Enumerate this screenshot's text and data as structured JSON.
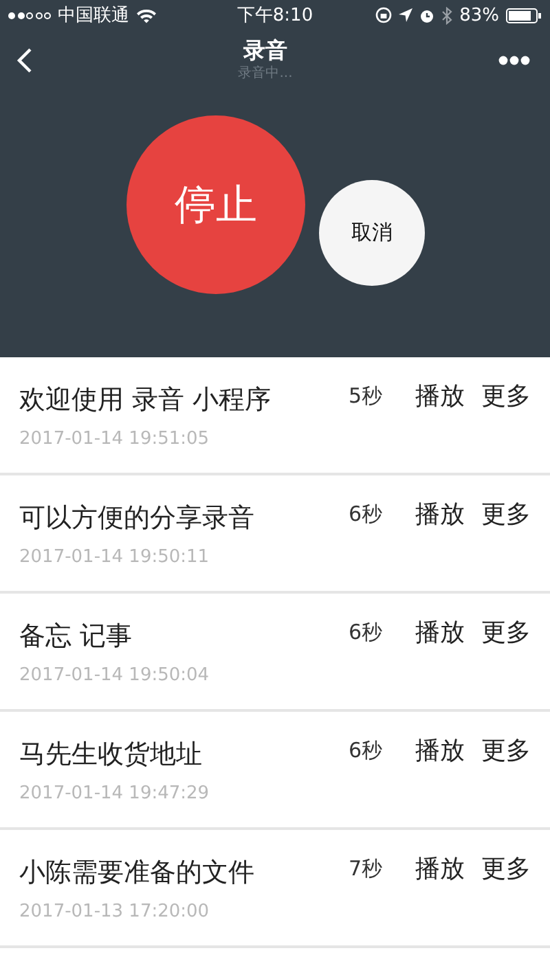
{
  "status_bar": {
    "carrier": "中国联通",
    "time": "下午8:10",
    "battery": "83%"
  },
  "nav": {
    "title": "录音",
    "subtitle": "录音中..."
  },
  "recorder": {
    "stop": "停止",
    "cancel": "取消"
  },
  "recordings": [
    {
      "title": "欢迎使用 录音 小程序",
      "date": "2017-01-14 19:51:05",
      "duration": "5秒",
      "play": "播放",
      "more": "更多"
    },
    {
      "title": "可以方便的分享录音",
      "date": "2017-01-14 19:50:11",
      "duration": "6秒",
      "play": "播放",
      "more": "更多"
    },
    {
      "title": "备忘 记事",
      "date": "2017-01-14 19:50:04",
      "duration": "6秒",
      "play": "播放",
      "more": "更多"
    },
    {
      "title": "马先生收货地址",
      "date": "2017-01-14 19:47:29",
      "duration": "6秒",
      "play": "播放",
      "more": "更多"
    },
    {
      "title": "小陈需要准备的文件",
      "date": "2017-01-13 17:20:00",
      "duration": "7秒",
      "play": "播放",
      "more": "更多"
    }
  ]
}
